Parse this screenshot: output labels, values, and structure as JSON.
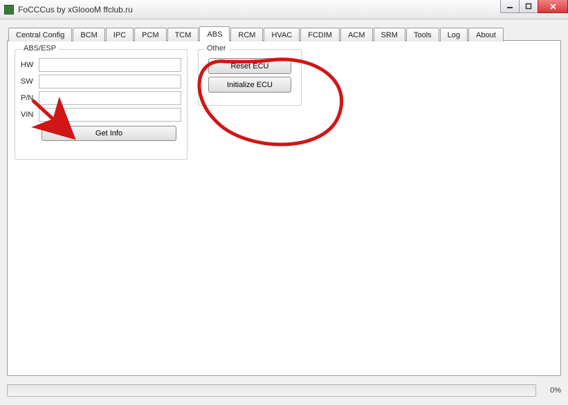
{
  "window": {
    "title": "FoCCCus by xGloooM ffclub.ru"
  },
  "tabs": [
    {
      "label": "Central Config"
    },
    {
      "label": "BCM"
    },
    {
      "label": "IPC"
    },
    {
      "label": "PCM"
    },
    {
      "label": "TCM"
    },
    {
      "label": "ABS",
      "active": true
    },
    {
      "label": "RCM"
    },
    {
      "label": "HVAC"
    },
    {
      "label": "FCDIM"
    },
    {
      "label": "ACM"
    },
    {
      "label": "SRM"
    },
    {
      "label": "Tools"
    },
    {
      "label": "Log"
    },
    {
      "label": "About"
    }
  ],
  "abs_group": {
    "legend": "ABS/ESP",
    "fields": {
      "hw": {
        "label": "HW",
        "value": ""
      },
      "sw": {
        "label": "SW",
        "value": ""
      },
      "pn": {
        "label": "P/N",
        "value": ""
      },
      "vin": {
        "label": "VIN",
        "value": ""
      }
    },
    "get_info": "Get Info"
  },
  "other_group": {
    "legend": "Other",
    "reset_ecu": "Reset ECU",
    "initialize_ecu": "Initialize ECU"
  },
  "status": {
    "percent": "0%"
  },
  "annotations": {
    "arrow_color": "#d01616",
    "circle_color": "#d01616"
  }
}
